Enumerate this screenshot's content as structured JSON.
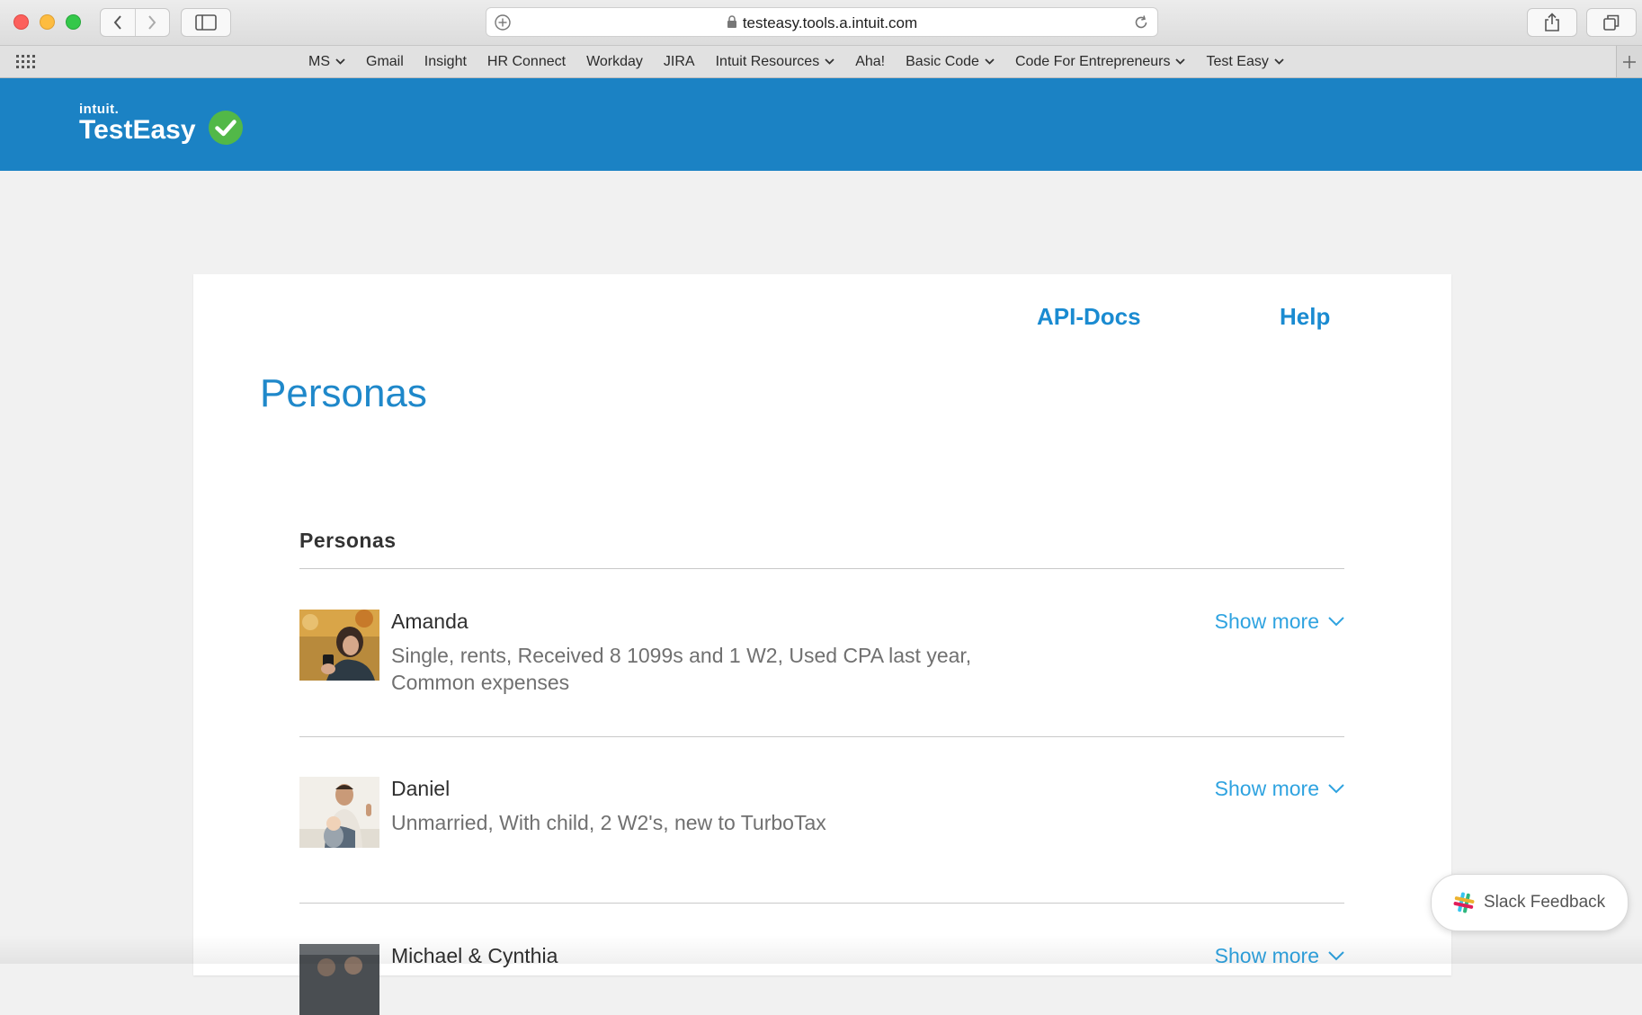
{
  "browser": {
    "url": "testeasy.tools.a.intuit.com",
    "bookmarks": [
      {
        "label": "MS",
        "dropdown": true
      },
      {
        "label": "Gmail",
        "dropdown": false
      },
      {
        "label": "Insight",
        "dropdown": false
      },
      {
        "label": "HR Connect",
        "dropdown": false
      },
      {
        "label": "Workday",
        "dropdown": false
      },
      {
        "label": "JIRA",
        "dropdown": false
      },
      {
        "label": "Intuit Resources",
        "dropdown": true
      },
      {
        "label": "Aha!",
        "dropdown": false
      },
      {
        "label": "Basic Code",
        "dropdown": true
      },
      {
        "label": "Code For Entrepreneurs",
        "dropdown": true
      },
      {
        "label": "Test Easy",
        "dropdown": true
      }
    ]
  },
  "app": {
    "brand_intuit": "intuit.",
    "brand_name": "TestEasy",
    "header_color": "#1b82c4"
  },
  "nav": {
    "api_docs": "API-Docs",
    "help": "Help"
  },
  "page": {
    "title": "Personas",
    "section_title": "Personas"
  },
  "personas": [
    {
      "name": "Amanda",
      "description": "Single, rents, Received 8 1099s and 1 W2, Used CPA last year, Common expenses",
      "action": "Show more"
    },
    {
      "name": "Daniel",
      "description": "Unmarried, With child, 2 W2's, new to TurboTax",
      "action": "Show more"
    },
    {
      "name": "Michael & Cynthia",
      "description": "",
      "action": "Show more"
    }
  ],
  "feedback": {
    "label": "Slack Feedback"
  }
}
